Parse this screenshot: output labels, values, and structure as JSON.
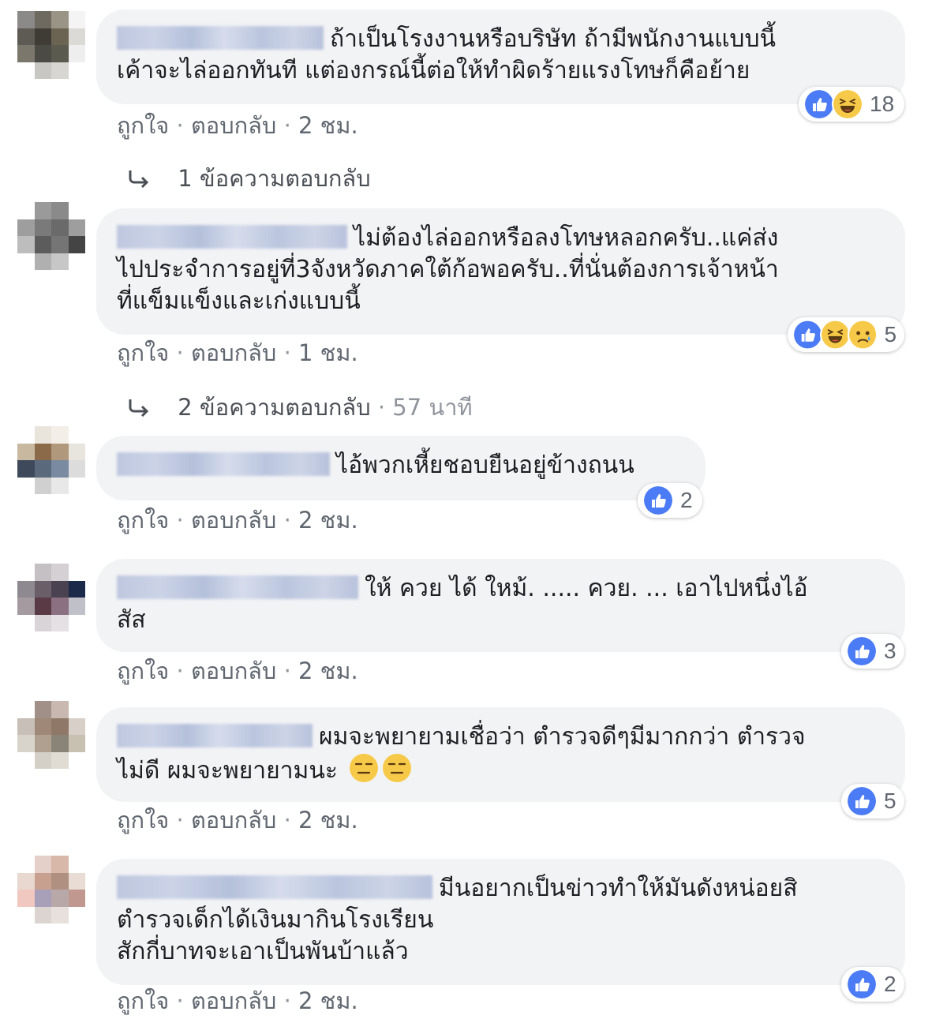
{
  "labels": {
    "like": "ถูกใจ",
    "reply": "ตอบกลับ",
    "separator": "·"
  },
  "comments": [
    {
      "text_line1": "ถ้าเป็นโรงงานหรือบริษัท ถ้ามีพนักงานแบบนี้",
      "text_line2": "เค้าจะไล่ออกทันที แต่องกรณ์นี้ต่อให้ทำผิดร้ายแรงโทษก็คือย้าย",
      "reaction_count": "18",
      "reactions": [
        "like-icon",
        "haha-icon"
      ],
      "time": "2 ชม.",
      "replies_label": "1 ข้อความตอบกลับ"
    },
    {
      "text_line1": "ไม่ต้องไล่ออกหรือลงโทษหลอกครับ..แค่ส่ง",
      "text_line2": "ไปประจำการอยู่ที่3จังหวัดภาคใต้ก้อพอครับ..ที่นั่นต้องการเจ้าหน้า",
      "text_line3": "ที่แข็มแข็งและเก่งแบบนี้",
      "reaction_count": "5",
      "reactions": [
        "like-icon",
        "haha-icon",
        "sad-icon"
      ],
      "time": "1 ชม.",
      "replies_label": "2 ข้อความตอบกลับ",
      "replies_time": "57 นาที"
    },
    {
      "text_line1": "ไอ้พวกเหี้ยชอบยืนอยู่ข้างถนน",
      "reaction_count": "2",
      "reactions": [
        "like-icon"
      ],
      "time": "2 ชม."
    },
    {
      "text_line1": "ให้ ควย ได้ ใหม้. ..... ควย. ... เอาไปหนึ่งไอ้",
      "text_line2": "สัส",
      "reaction_count": "3",
      "reactions": [
        "like-icon"
      ],
      "time": "2 ชม."
    },
    {
      "text_line1": "ผมจะพยายามเชื่อว่า ตำรวจดีๆมีมากกว่า ตำรวจ",
      "text_line2": "ไม่ดี ผมจะพยายามนะ",
      "reaction_count": "5",
      "reactions": [
        "like-icon"
      ],
      "time": "2 ชม."
    },
    {
      "text_line1": "มีนอยากเป็นข่าวทำให้มันดังหน่อยสิ",
      "text_line2": "ตำรวจเด็กได้เงินมากินโรงเรียน",
      "text_line3": "สักกี่บาทจะเอาเป็นพันบ้าแล้ว",
      "reaction_count": "2",
      "reactions": [
        "like-icon"
      ],
      "time": "2 ชม."
    }
  ],
  "colors": {
    "bubble": "#f2f3f5",
    "like_blue": "#4b7bf5",
    "haha_yellow": "#f7c948",
    "meta_gray": "#606770"
  }
}
